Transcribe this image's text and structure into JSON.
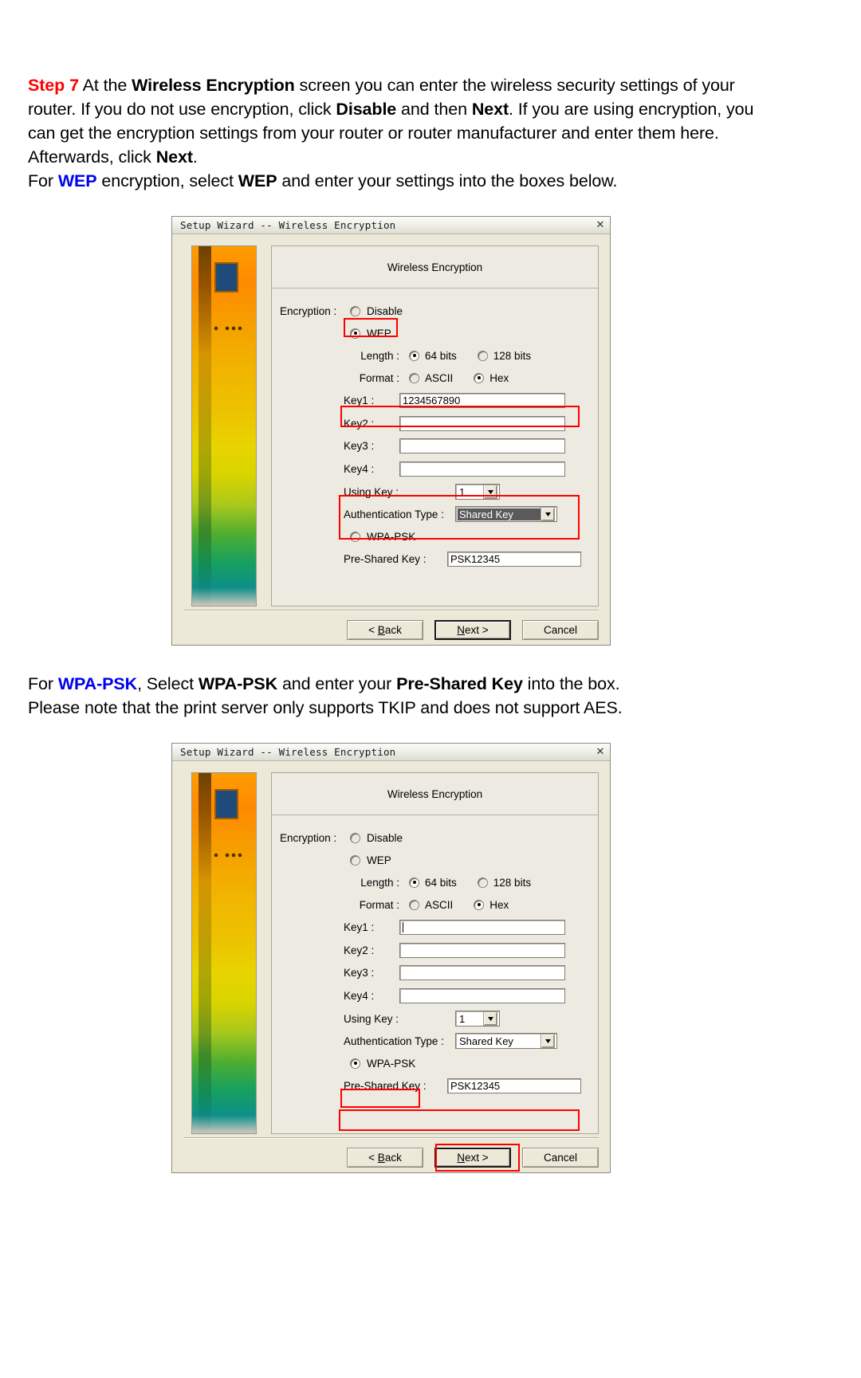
{
  "paragraphs": {
    "step7": {
      "step_label": "Step 7",
      "t1": " At the ",
      "b1": "Wireless Encryption",
      "t2": " screen you can enter the wireless security settings of your router.  If you do not use encryption, click ",
      "b2": "Disable",
      "t3": " and then ",
      "b3": "Next",
      "t4": ".  If you are using encryption, you can get the encryption settings from your router or router manufacturer and enter them here.  Afterwards, click ",
      "b4": "Next",
      "t5": ".",
      "t6": "For ",
      "wep_blue": "WEP",
      "t7": " encryption, select ",
      "b5": "WEP",
      "t8": " and enter your settings into the boxes below."
    },
    "wpa": {
      "t1": "For ",
      "wpa_blue": "WPA-PSK",
      "t2": ", Select ",
      "b1": "WPA-PSK",
      "t3": " and enter your ",
      "b2": "Pre-Shared Key",
      "t4": " into the box.",
      "t5": "Please note that the print server only supports TKIP and does not support AES."
    }
  },
  "colors": {
    "step_red": "#ff0000",
    "link_blue": "#0000ee",
    "highlight_red": "#ff0000",
    "dialog_face": "#ece9d8",
    "panel_face": "#eceae1"
  },
  "dialog1": {
    "title": "Setup Wizard -- Wireless Encryption",
    "close_icon": "close-icon",
    "group_title": "Wireless Encryption",
    "encryption_label": "Encryption :",
    "options": {
      "disable": "Disable",
      "wep": "WEP",
      "wpa_psk": "WPA-PSK"
    },
    "selected_encryption": "WEP",
    "length_label": "Length :",
    "length_options": [
      "64 bits",
      "128 bits"
    ],
    "length_selected": "64 bits",
    "format_label": "Format :",
    "format_options": [
      "ASCII",
      "Hex"
    ],
    "format_selected": "Hex",
    "keys": [
      {
        "label": "Key1 :",
        "value": "1234567890"
      },
      {
        "label": "Key2 :",
        "value": ""
      },
      {
        "label": "Key3 :",
        "value": ""
      },
      {
        "label": "Key4 :",
        "value": ""
      }
    ],
    "using_key_label": "Using Key :",
    "using_key_value": "1",
    "auth_type_label": "Authentication Type :",
    "auth_type_value": "Shared Key",
    "psk_label": "Pre-Shared Key :",
    "psk_value": "PSK12345",
    "buttons": {
      "back": "< Back",
      "back_mnemonic": "B",
      "next": "Next >",
      "next_mnemonic": "N",
      "cancel": "Cancel",
      "default": "Next >"
    },
    "highlights": [
      "wep-radio-row",
      "key1-row",
      "using-key-and-auth-type"
    ]
  },
  "dialog2": {
    "title": "Setup Wizard -- Wireless Encryption",
    "close_icon": "close-icon",
    "group_title": "Wireless Encryption",
    "encryption_label": "Encryption :",
    "options": {
      "disable": "Disable",
      "wep": "WEP",
      "wpa_psk": "WPA-PSK"
    },
    "selected_encryption": "WPA-PSK",
    "length_label": "Length :",
    "length_options": [
      "64 bits",
      "128 bits"
    ],
    "length_selected": "64 bits",
    "format_label": "Format :",
    "format_options": [
      "ASCII",
      "Hex"
    ],
    "format_selected": "Hex",
    "keys": [
      {
        "label": "Key1 :",
        "value": ""
      },
      {
        "label": "Key2 :",
        "value": ""
      },
      {
        "label": "Key3 :",
        "value": ""
      },
      {
        "label": "Key4 :",
        "value": ""
      }
    ],
    "using_key_label": "Using Key :",
    "using_key_value": "1",
    "auth_type_label": "Authentication Type :",
    "auth_type_value": "Shared Key",
    "psk_label": "Pre-Shared Key :",
    "psk_value": "PSK12345",
    "buttons": {
      "back": "< Back",
      "back_mnemonic": "B",
      "next": "Next >",
      "next_mnemonic": "N",
      "cancel": "Cancel",
      "default": "Next >"
    },
    "highlights": [
      "wpa-psk-radio-row",
      "pre-shared-key-row",
      "next-button"
    ]
  }
}
